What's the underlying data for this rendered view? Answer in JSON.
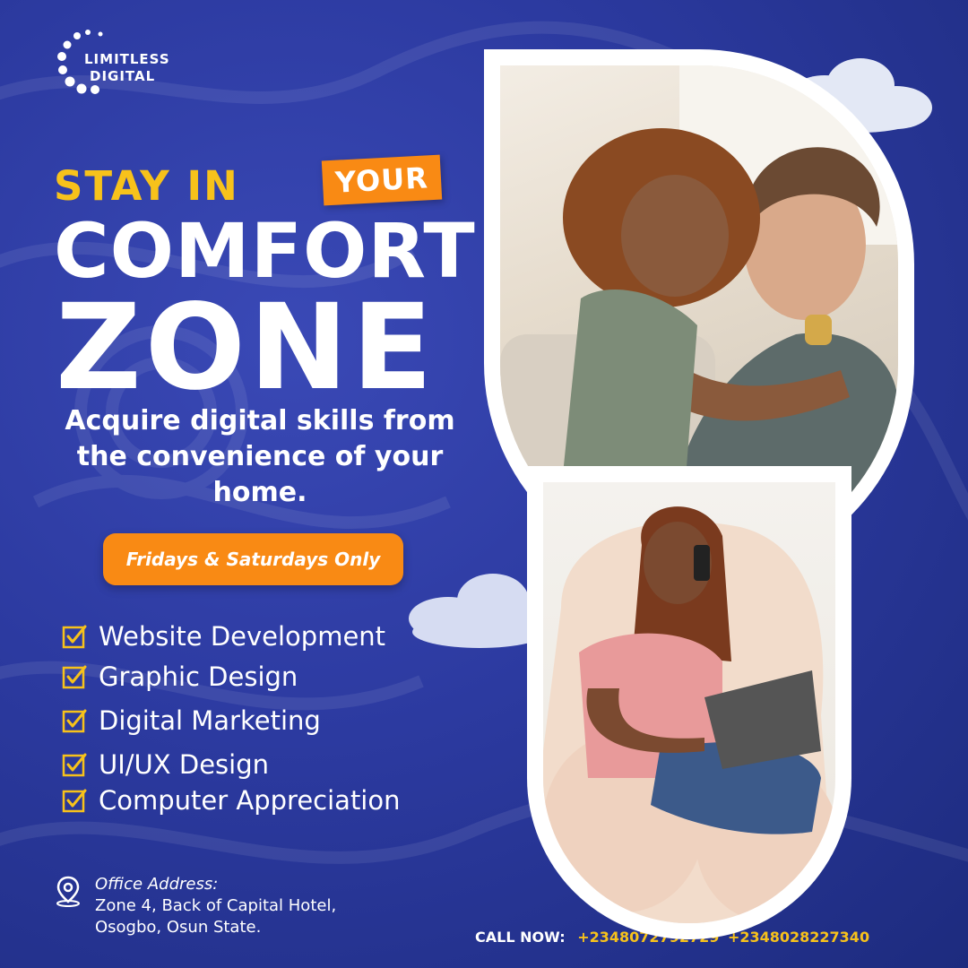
{
  "brand": {
    "line1": "LIMITLESS",
    "line2": "DIGITAL"
  },
  "headline": {
    "stay_in": "STAY IN",
    "your": "YOUR",
    "comfort": "COMFORT",
    "zone": "ZONE"
  },
  "subline": "Acquire digital skills from the convenience of your home.",
  "days_button": "Fridays & Saturdays Only",
  "skills": [
    "Website Development",
    "Graphic Design",
    "Digital Marketing",
    "UI/UX Design",
    "Computer Appreciation"
  ],
  "address": {
    "title": "Office Address:",
    "line1": "Zone 4, Back of Capital Hotel,",
    "line2": "Osogbo, Osun State."
  },
  "call": {
    "label": "CALL NOW:",
    "phone1": "+2348072792729",
    "phone2": "+2348028227340"
  },
  "colors": {
    "background": "#2c3aa0",
    "accent_yellow": "#f7c21b",
    "accent_orange": "#f98a14",
    "check_color": "#f7c21b"
  },
  "icons": {
    "logo": "dotted-circle-icon",
    "checkbox": "checkbox-checked-icon",
    "location": "location-pin-icon"
  }
}
